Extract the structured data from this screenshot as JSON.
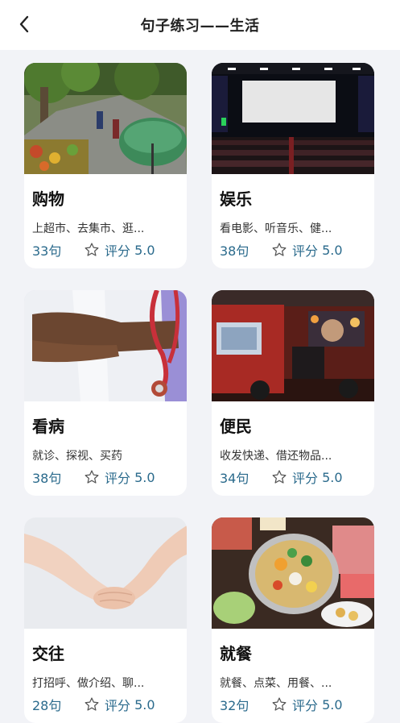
{
  "header": {
    "title": "句子练习——生活"
  },
  "rating_label": "评分",
  "colors": {
    "accent": "#2a6a8c",
    "background": "#f2f3f7"
  },
  "cards": [
    {
      "name": "购物",
      "desc": "上超市、去集市、逛...",
      "count": "33句",
      "score": "5.0"
    },
    {
      "name": "娱乐",
      "desc": "看电影、听音乐、健...",
      "count": "38句",
      "score": "5.0"
    },
    {
      "name": "看病",
      "desc": "就诊、探视、买药",
      "count": "38句",
      "score": "5.0"
    },
    {
      "name": "便民",
      "desc": "收发快递、借还物品...",
      "count": "34句",
      "score": "5.0"
    },
    {
      "name": "交往",
      "desc": "打招呼、做介绍、聊...",
      "count": "28句",
      "score": "5.0"
    },
    {
      "name": "就餐",
      "desc": "就餐、点菜、用餐、...",
      "count": "32句",
      "score": "5.0"
    }
  ]
}
